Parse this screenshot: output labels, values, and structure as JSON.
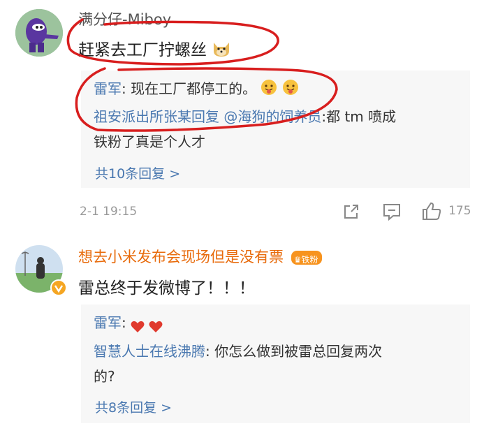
{
  "comments": [
    {
      "username": "满分仔-Miboy",
      "text": "赶紧去工厂拧螺丝",
      "text_emoji_icon": "doge-emoji-icon",
      "replies": [
        {
          "author": "雷军",
          "sep": ":",
          "content": "现在工厂都停工的。",
          "emoji_icons": [
            "tongue-emoji-icon",
            "tongue-emoji-icon"
          ]
        },
        {
          "author": "祖安派出所张某回复",
          "mention": "@海狗的饲养员",
          "sep": ":",
          "content_line1": "都 tm 喷成",
          "content_line2": "铁粉了真是个人才"
        }
      ],
      "more_replies": "共10条回复 >",
      "timestamp": "2-1 19:15",
      "like_count": "175"
    },
    {
      "username": "想去小米发布会现场但是没有票",
      "fan_badge": "铁粉",
      "text": "雷总终于发微博了！！！",
      "replies": [
        {
          "author": "雷军",
          "sep": ":",
          "emoji_icons": [
            "heart-icon",
            "heart-icon"
          ]
        },
        {
          "author": "智慧人士在线沸腾",
          "sep": ":",
          "content_line1": "你怎么做到被雷总回复两次",
          "content_line2": "的?"
        }
      ],
      "more_replies": "共8条回复 >"
    }
  ],
  "colors": {
    "reply_author": "#4a78b0",
    "orange_name": "#e86b0c",
    "heart": "#e03a2e",
    "annotation": "#d81e1e",
    "reply_bg": "#f7f7f7"
  }
}
